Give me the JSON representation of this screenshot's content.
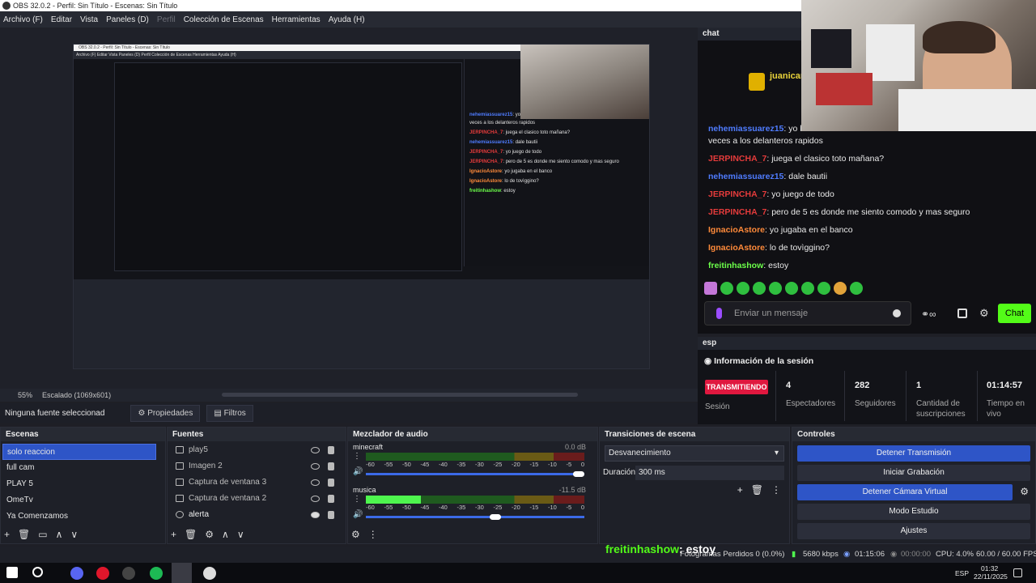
{
  "titlebar": {
    "title": "OBS 32.0.2 - Perfil: Sin Título - Escenas: Sin Título"
  },
  "menu": [
    "Archivo (F)",
    "Editar",
    "Vista",
    "Paneles (D)",
    "Perfil",
    "Colección de Escenas",
    "Herramientas",
    "Ayuda (H)"
  ],
  "preview": {
    "zoom": "55%",
    "scaling": "Escalado (1069x601)",
    "no_source": "Ninguna fuente seleccionad",
    "props_tab": "Propiedades",
    "filters_tab": "Filtros"
  },
  "chat": {
    "header": "chat",
    "username": "juanicar",
    "messages": [
      {
        "user": "nehemiassuarez15",
        "text": ": yo ba",
        "color": "u1"
      },
      {
        "user": "",
        "text": "veces a los delanteros rapidos",
        "color": ""
      },
      {
        "user": "JERPINCHA_7",
        "text": ": juega el clasico toto mañana?",
        "color": "u2"
      },
      {
        "user": "nehemiassuarez15",
        "text": ": dale bautii",
        "color": "u1"
      },
      {
        "user": "JERPINCHA_7",
        "text": ": yo juego de todo",
        "color": "u2"
      },
      {
        "user": "JERPINCHA_7",
        "text": ": pero de 5 es donde me siento comodo y mas seguro",
        "color": "u2"
      },
      {
        "user": "IgnacioAstore",
        "text": ": yo jugaba en el banco",
        "color": "u3"
      },
      {
        "user": "IgnacioAstore",
        "text": ": lo de tovìggino?",
        "color": "u3"
      },
      {
        "user": "freitinhashow",
        "text": ": estoy",
        "color": "u4"
      }
    ],
    "input_placeholder": "Enviar un mensaje",
    "send_label": "Chat"
  },
  "session": {
    "header": "esp",
    "title": "Información de la sesión",
    "status": "TRANSMITIENDO",
    "status_label": "Sesión",
    "viewers": "4",
    "viewers_label": "Espectadores",
    "followers": "282",
    "followers_label": "Seguidores",
    "subs": "1",
    "subs_label": "Cantidad de suscripciones",
    "time": "01:14:57",
    "time_label": "Tiempo en vivo"
  },
  "scenes": {
    "header": "Escenas",
    "items": [
      "solo reaccion",
      "full cam",
      "PLAY 5",
      "OmeTv",
      "Ya Comenzamos"
    ]
  },
  "sources": {
    "header": "Fuentes",
    "items": [
      "play5",
      "Imagen 2",
      "Captura de ventana 3",
      "Captura de ventana 2",
      "alerta"
    ]
  },
  "mixer": {
    "header": "Mezclador de audio",
    "channels": [
      {
        "name": "minecraft",
        "db": "0.0 dB",
        "level": 0.0,
        "volume": 1.0
      },
      {
        "name": "musica",
        "db": "-11.5 dB",
        "level": 0.25,
        "volume": 0.62
      }
    ],
    "scale": [
      "-60",
      "-55",
      "-50",
      "-45",
      "-40",
      "-35",
      "-30",
      "-25",
      "-20",
      "-15",
      "-10",
      "-5",
      "0"
    ]
  },
  "transitions": {
    "header": "Transiciones de escena",
    "selected": "Desvanecimiento",
    "duration_label": "Duración",
    "duration": "300 ms"
  },
  "controls": {
    "header": "Controles",
    "buttons": [
      "Detener Transmisión",
      "Iniciar Grabación",
      "Detener Cámara Virtual",
      "Modo Estudio",
      "Ajustes"
    ]
  },
  "status": {
    "dropped": "Fotogramas Perdidos 0 (0.0%)",
    "bitrate": "5680 kbps",
    "stream_time": "01:15:06",
    "rec_time": "00:00:00",
    "cpu": "CPU: 4.0%",
    "fps": "60.00 / 60.00 FPS"
  },
  "overlay": {
    "user": "freitinhashow",
    "text": ": estoy"
  },
  "taskbar": {
    "lang": "ESP",
    "time": "01:32",
    "date": "22/11/2025"
  }
}
